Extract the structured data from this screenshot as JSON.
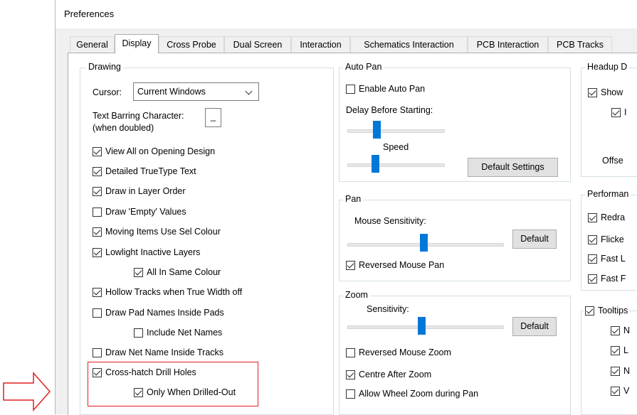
{
  "window": {
    "title": "Preferences"
  },
  "tabs": [
    {
      "label": "General"
    },
    {
      "label": "Display",
      "active": true
    },
    {
      "label": "Cross Probe"
    },
    {
      "label": "Dual Screen"
    },
    {
      "label": "Interaction"
    },
    {
      "label": "Schematics Interaction"
    },
    {
      "label": "PCB Interaction"
    },
    {
      "label": "PCB Tracks"
    }
  ],
  "drawing": {
    "title": "Drawing",
    "cursor_label": "Cursor:",
    "cursor_value": "Current Windows",
    "barring_label": "Text Barring Character:",
    "barring_sub": "(when doubled)",
    "barring_value": "_",
    "options": {
      "view_all": {
        "label": "View All on Opening Design",
        "checked": true
      },
      "truetype": {
        "label": "Detailed TrueType Text",
        "checked": true
      },
      "layer_order": {
        "label": "Draw in Layer Order",
        "checked": true
      },
      "empty_values": {
        "label": "Draw 'Empty' Values",
        "checked": false
      },
      "sel_colour": {
        "label": "Moving Items Use Sel Colour",
        "checked": true
      },
      "lowlight": {
        "label": "Lowlight Inactive Layers",
        "checked": true
      },
      "same_colour": {
        "label": "All In Same Colour",
        "checked": true
      },
      "hollow": {
        "label": "Hollow Tracks when True Width off",
        "checked": true
      },
      "pad_names": {
        "label": "Draw Pad Names Inside Pads",
        "checked": false
      },
      "net_names": {
        "label": "Include Net Names",
        "checked": false
      },
      "net_tracks": {
        "label": "Draw Net Name Inside Tracks",
        "checked": false
      },
      "crosshatch": {
        "label": "Cross-hatch Drill Holes",
        "checked": true
      },
      "drilled_out": {
        "label": "Only When Drilled-Out",
        "checked": true
      }
    }
  },
  "autopan": {
    "title": "Auto Pan",
    "enable": {
      "label": "Enable Auto Pan",
      "checked": false
    },
    "delay_label": "Delay Before Starting:",
    "speed_label": "Speed",
    "default_settings": "Default Settings"
  },
  "pan": {
    "title": "Pan",
    "sensitivity_label": "Mouse Sensitivity:",
    "default": "Default",
    "reversed": {
      "label": "Reversed Mouse Pan",
      "checked": true
    }
  },
  "zoom": {
    "title": "Zoom",
    "sensitivity_label": "Sensitivity:",
    "default": "Default",
    "reversed": {
      "label": "Reversed Mouse Zoom",
      "checked": false
    },
    "centre": {
      "label": "Centre After Zoom",
      "checked": true
    },
    "wheel": {
      "label": "Allow Wheel Zoom during Pan",
      "checked": false
    }
  },
  "headup": {
    "title": "Headup D",
    "show": {
      "label": "Show",
      "checked": true
    },
    "sub": {
      "label": "I",
      "checked": true
    },
    "offset_label": "Offse"
  },
  "performance": {
    "title": "Performan",
    "items": [
      {
        "label": "Redra",
        "checked": true
      },
      {
        "label": "Flicke",
        "checked": true
      },
      {
        "label": "Fast L",
        "checked": true
      },
      {
        "label": "Fast F",
        "checked": true
      }
    ]
  },
  "tooltips": {
    "title": {
      "label": "Tooltips",
      "checked": true
    },
    "items": [
      {
        "label": "N",
        "checked": true
      },
      {
        "label": "L",
        "checked": true
      },
      {
        "label": "N",
        "checked": true
      },
      {
        "label": "V",
        "checked": true
      }
    ]
  },
  "colors": {
    "accent": "#0078d7",
    "highlight": "#e02020"
  }
}
